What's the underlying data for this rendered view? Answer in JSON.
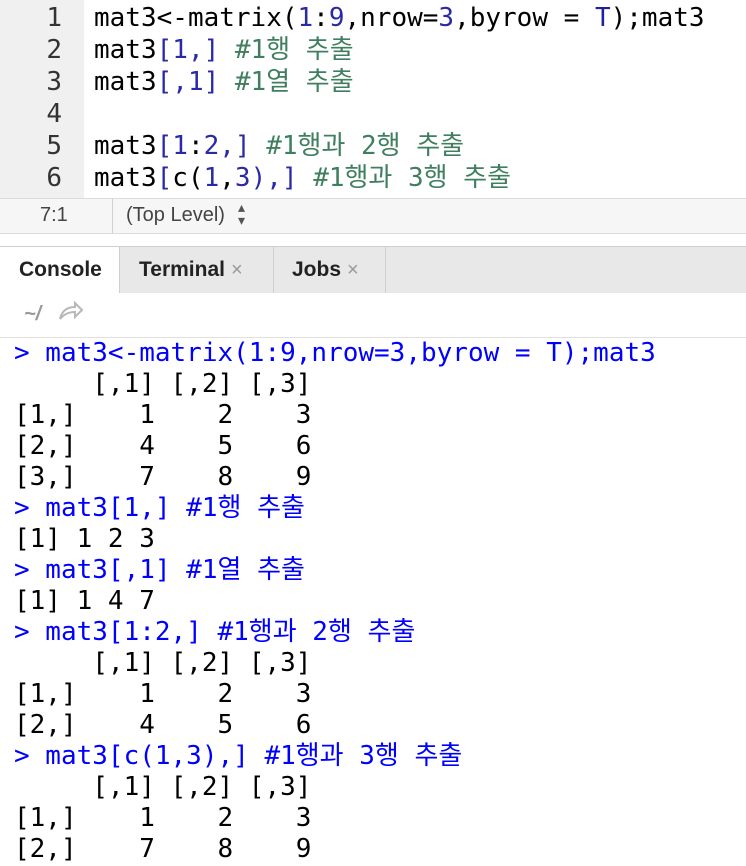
{
  "editor": {
    "lines": [
      {
        "no": "1",
        "tokens": [
          {
            "t": "mat3",
            "c": "id"
          },
          {
            "t": "<-",
            "c": "op"
          },
          {
            "t": "matrix(",
            "c": "id"
          },
          {
            "t": "1",
            "c": "num"
          },
          {
            "t": ":",
            "c": "op"
          },
          {
            "t": "9",
            "c": "num"
          },
          {
            "t": ",nrow=",
            "c": "id"
          },
          {
            "t": "3",
            "c": "num"
          },
          {
            "t": ",byrow = ",
            "c": "id"
          },
          {
            "t": "T",
            "c": "kw"
          },
          {
            "t": ");mat3",
            "c": "id"
          }
        ]
      },
      {
        "no": "2",
        "tokens": [
          {
            "t": "mat3",
            "c": "id"
          },
          {
            "t": "[",
            "c": "punc"
          },
          {
            "t": "1",
            "c": "num"
          },
          {
            "t": ",] ",
            "c": "punc"
          },
          {
            "t": "#1행 추출",
            "c": "cmt"
          }
        ]
      },
      {
        "no": "3",
        "tokens": [
          {
            "t": "mat3",
            "c": "id"
          },
          {
            "t": "[,",
            "c": "punc"
          },
          {
            "t": "1",
            "c": "num"
          },
          {
            "t": "] ",
            "c": "punc"
          },
          {
            "t": "#1열 추출",
            "c": "cmt"
          }
        ]
      },
      {
        "no": "4",
        "tokens": []
      },
      {
        "no": "5",
        "tokens": [
          {
            "t": "mat3",
            "c": "id"
          },
          {
            "t": "[",
            "c": "punc"
          },
          {
            "t": "1",
            "c": "num"
          },
          {
            "t": ":",
            "c": "op"
          },
          {
            "t": "2",
            "c": "num"
          },
          {
            "t": ",] ",
            "c": "punc"
          },
          {
            "t": "#1행과 2행 추출",
            "c": "cmt"
          }
        ]
      },
      {
        "no": "6",
        "tokens": [
          {
            "t": "mat3",
            "c": "id"
          },
          {
            "t": "[",
            "c": "punc"
          },
          {
            "t": "c(",
            "c": "id"
          },
          {
            "t": "1",
            "c": "num"
          },
          {
            "t": ",",
            "c": "id"
          },
          {
            "t": "3",
            "c": "num"
          },
          {
            "t": "),] ",
            "c": "punc"
          },
          {
            "t": "#1행과 3행 추출",
            "c": "cmt"
          }
        ]
      }
    ]
  },
  "status": {
    "cursor_position": "7:1",
    "scope": "(Top Level)",
    "scope_arrows": "▴▾"
  },
  "tabs": [
    {
      "label": "Console",
      "active": true,
      "closable": false
    },
    {
      "label": "Terminal",
      "active": false,
      "closable": true
    },
    {
      "label": "Jobs",
      "active": false,
      "closable": true
    }
  ],
  "tab_close_glyph": "×",
  "console": {
    "path": "~/",
    "nav_icon": "share-arrow-icon",
    "lines": [
      {
        "kind": "in",
        "text": "> mat3<-matrix(1:9,nrow=3,byrow = T);mat3"
      },
      {
        "kind": "out",
        "text": "     [,1] [,2] [,3]"
      },
      {
        "kind": "out",
        "text": "[1,]    1    2    3"
      },
      {
        "kind": "out",
        "text": "[2,]    4    5    6"
      },
      {
        "kind": "out",
        "text": "[3,]    7    8    9"
      },
      {
        "kind": "in",
        "text": "> mat3[1,] #1행 추출"
      },
      {
        "kind": "out",
        "text": "[1] 1 2 3"
      },
      {
        "kind": "in",
        "text": "> mat3[,1] #1열 추출"
      },
      {
        "kind": "out",
        "text": "[1] 1 4 7"
      },
      {
        "kind": "in",
        "text": "> mat3[1:2,] #1행과 2행 추출"
      },
      {
        "kind": "out",
        "text": "     [,1] [,2] [,3]"
      },
      {
        "kind": "out",
        "text": "[1,]    1    2    3"
      },
      {
        "kind": "out",
        "text": "[2,]    4    5    6"
      },
      {
        "kind": "in",
        "text": "> mat3[c(1,3),] #1행과 3행 추출"
      },
      {
        "kind": "out",
        "text": "     [,1] [,2] [,3]"
      },
      {
        "kind": "out",
        "text": "[1,]    1    2    3"
      },
      {
        "kind": "out",
        "text": "[2,]    7    8    9"
      }
    ]
  }
}
